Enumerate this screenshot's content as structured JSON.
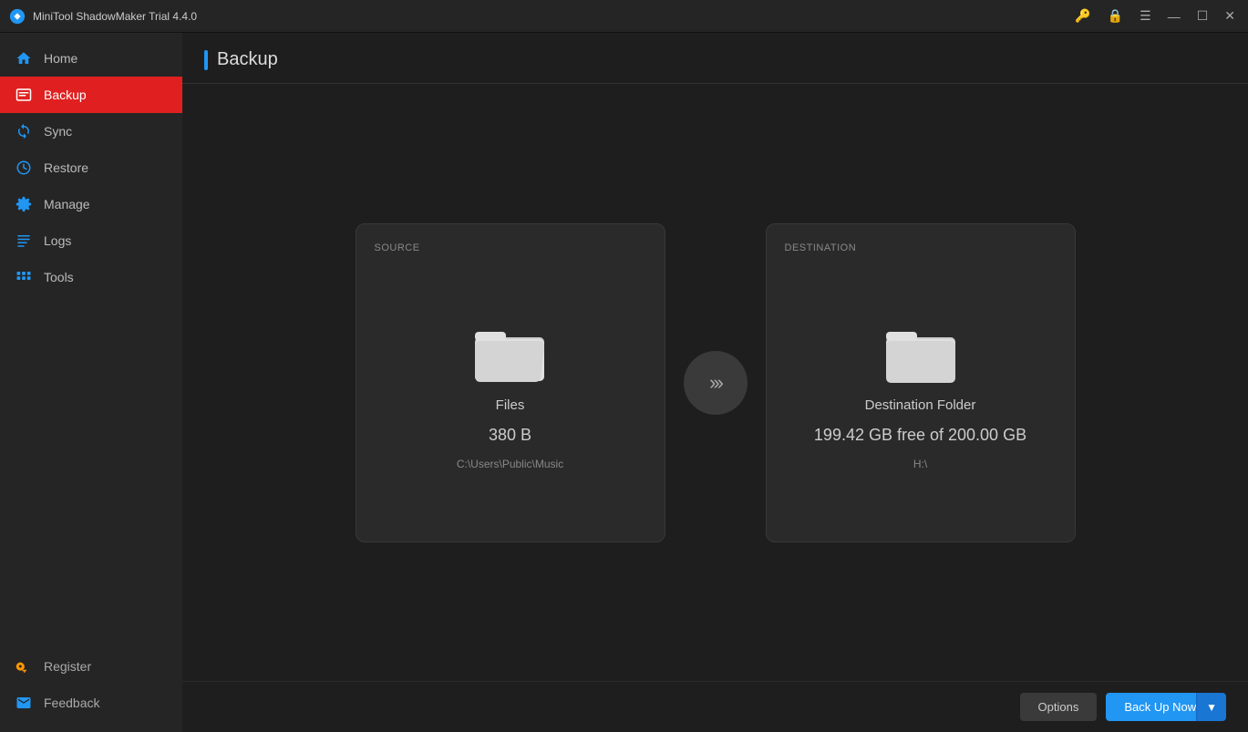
{
  "titlebar": {
    "title": "MiniTool ShadowMaker Trial 4.4.0",
    "controls": {
      "menu_icon": "☰",
      "minimize": "—",
      "maximize": "☐",
      "close": "✕"
    }
  },
  "sidebar": {
    "items": [
      {
        "id": "home",
        "label": "Home",
        "active": false
      },
      {
        "id": "backup",
        "label": "Backup",
        "active": true
      },
      {
        "id": "sync",
        "label": "Sync",
        "active": false
      },
      {
        "id": "restore",
        "label": "Restore",
        "active": false
      },
      {
        "id": "manage",
        "label": "Manage",
        "active": false
      },
      {
        "id": "logs",
        "label": "Logs",
        "active": false
      },
      {
        "id": "tools",
        "label": "Tools",
        "active": false
      }
    ],
    "bottom_items": [
      {
        "id": "register",
        "label": "Register"
      },
      {
        "id": "feedback",
        "label": "Feedback"
      }
    ]
  },
  "page": {
    "title": "Backup"
  },
  "source_card": {
    "section_label": "SOURCE",
    "file_type": "Files",
    "file_size": "380 B",
    "file_path": "C:\\Users\\Public\\Music"
  },
  "destination_card": {
    "section_label": "DESTINATION",
    "folder_label": "Destination Folder",
    "free_space": "199.42 GB free of 200.00 GB",
    "drive": "H:\\"
  },
  "footer": {
    "options_label": "Options",
    "backup_now_label": "Back Up Now",
    "dropdown_arrow": "▼"
  }
}
